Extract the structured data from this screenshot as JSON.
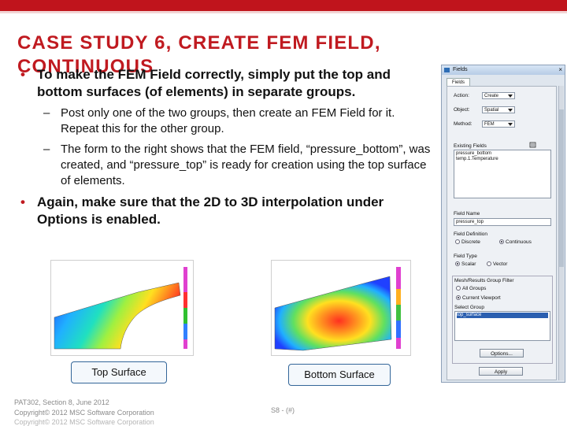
{
  "slide": {
    "title": "CASE STUDY 6, CREATE FEM FIELD, CONTINUOUS",
    "bullets": [
      {
        "text": "To make the FEM Field correctly, simply put the top and bottom surfaces (of elements) in separate groups."
      },
      {
        "text": "Post only one of the two groups, then create an FEM Field for it. Repeat this for the other group."
      },
      {
        "text": "The form to the right shows that the FEM field, “pressure_bottom”, was created, and “pressure_top” is ready for creation using the top surface of elements."
      },
      {
        "text": "Again, make sure that the 2D to 3D interpolation under Options is enabled."
      }
    ],
    "bullet_glyph": "•",
    "dash_glyph": "–",
    "captions": {
      "top": "Top Surface",
      "bottom": "Bottom Surface"
    },
    "footer": {
      "line1": "PAT302, Section 8, June 2012",
      "line2": "Copyright© 2012 MSC Software Corporation",
      "line3": "Copyright© 2012 MSC Software Corporation",
      "page": "S8 - (#)"
    },
    "colors": {
      "accent": "#c01a20",
      "bar": "#c0141c"
    }
  },
  "fields_panel": {
    "window_title": "Fields",
    "close_glyph": "×",
    "tab": "Fields",
    "action_label": "Action:",
    "action_value": "Create",
    "object_label": "Object:",
    "object_value": "Spatial",
    "method_label": "Method:",
    "method_value": "FEM",
    "existing_label": "Existing Fields",
    "existing": [
      "pressure_bottom",
      "temp.1.Temperature"
    ],
    "field_name_label": "Field Name",
    "field_name_value": "pressure_top",
    "def_label": "Field Definition",
    "def_opt1": "Discrete",
    "def_opt2": "Continuous",
    "type_label": "Field Type",
    "type_opt1": "Scalar",
    "type_opt2": "Vector",
    "filter_label": "Mesh/Results Group Filter",
    "filter_opt1": "All Groups",
    "filter_opt2": "Current Viewport",
    "select_group_label": "Select Group",
    "group_selected": "top_surface",
    "options_button": "Options...",
    "apply_button": "Apply"
  }
}
